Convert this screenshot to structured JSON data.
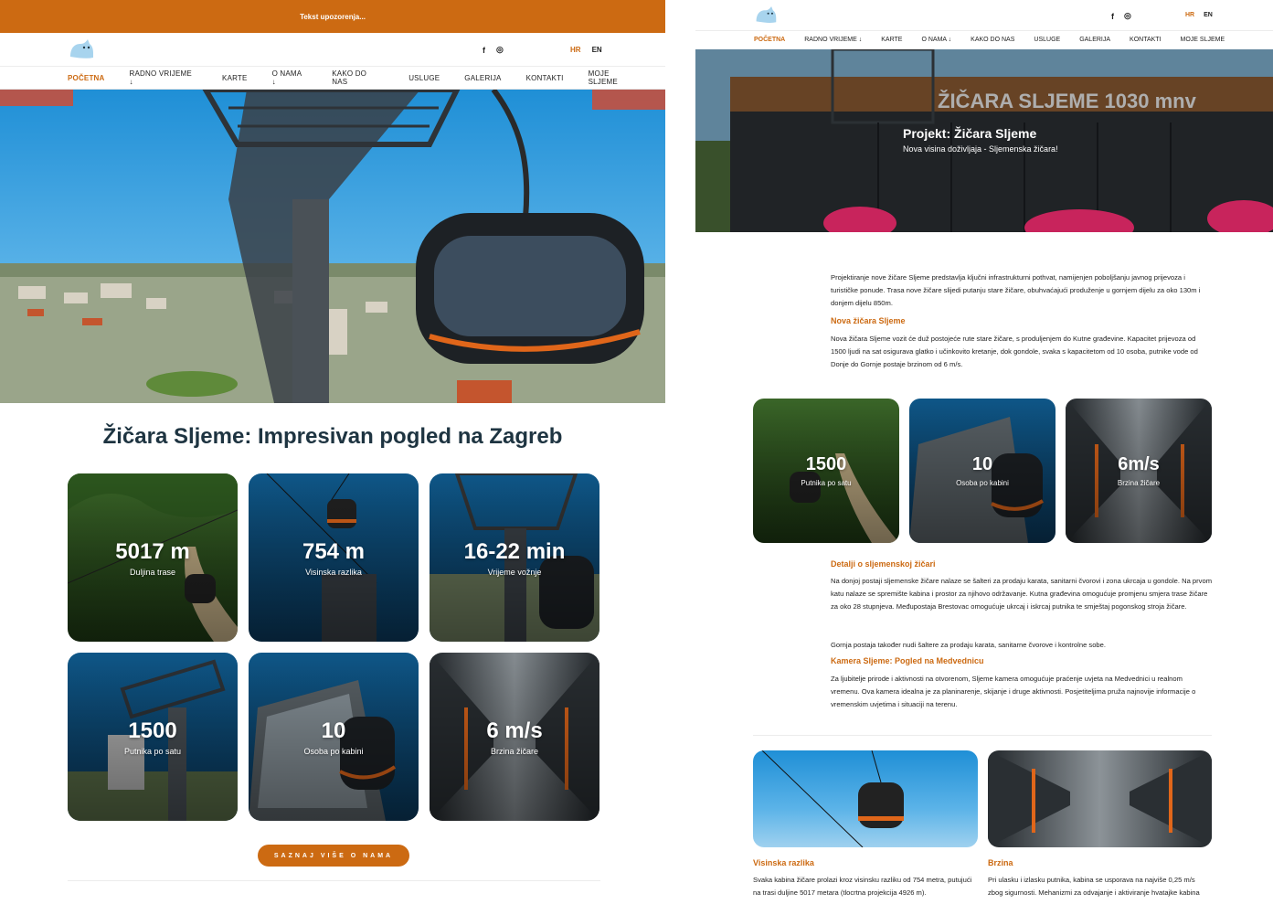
{
  "colors": {
    "accent": "#cc6a12",
    "title": "#1e3441"
  },
  "left": {
    "alert_text": "Tekst upozorenja...",
    "social": {
      "facebook": "f",
      "instagram": "◎"
    },
    "lang": {
      "hr": "HR",
      "en": "EN"
    },
    "nav": [
      {
        "label": "POČETNA",
        "active": true
      },
      {
        "label": "RADNO VRIJEME ↓"
      },
      {
        "label": "KARTE"
      },
      {
        "label": "O NAMA ↓"
      },
      {
        "label": "KAKO DO NAS"
      },
      {
        "label": "USLUGE"
      },
      {
        "label": "GALERIJA"
      },
      {
        "label": "KONTAKTI"
      },
      {
        "label": "MOJE SLJEME"
      }
    ],
    "title": "Žičara Sljeme: Impresivan pogled na Zagreb",
    "stats": [
      {
        "value": "5017 m",
        "label": "Duljina trase"
      },
      {
        "value": "754 m",
        "label": "Visinska razlika"
      },
      {
        "value": "16-22 min",
        "label": "Vrijeme vožnje"
      },
      {
        "value": "1500",
        "label": "Putnika po satu"
      },
      {
        "value": "10",
        "label": "Osoba po kabini"
      },
      {
        "value": "6 m/s",
        "label": "Brzina žičare"
      }
    ],
    "cta_label": "SAZNAJ VIŠE O NAMA"
  },
  "right": {
    "social": {
      "facebook": "f",
      "instagram": "◎"
    },
    "lang": {
      "hr": "HR",
      "en": "EN"
    },
    "nav": [
      {
        "label": "POČETNA",
        "active": true
      },
      {
        "label": "RADNO VRIJEME ↓"
      },
      {
        "label": "KARTE"
      },
      {
        "label": "O NAMA ↓"
      },
      {
        "label": "KAKO DO NAS"
      },
      {
        "label": "USLUGE"
      },
      {
        "label": "GALERIJA"
      },
      {
        "label": "KONTAKTI"
      },
      {
        "label": "MOJE SLJEME"
      }
    ],
    "hero_sign": "ŽIČARA SLJEME 1030 mnv",
    "hero_title": "Projekt: Žičara Sljeme",
    "hero_subtitle": "Nova visina doživljaja - Sljemenska žičara!",
    "intro": "Projektiranje nove žičare Sljeme predstavlja ključni infrastrukturni pothvat, namijenjen poboljšanju javnog prijevoza i turističke ponude. Trasa nove žičare slijedi putanju stare žičare, obuhvaćajući produženje u gornjem dijelu za oko 130m i donjem dijelu 850m.",
    "section1_title": "Nova žičara Sljeme",
    "section1_text": "Nova žičara Sljeme vozit će duž postojeće rute stare žičare, s produljenjem do Kutne građevine. Kapacitet prijevoza od 1500 ljudi na sat osigurava glatko i učinkovito kretanje, dok gondole, svaka s kapacitetom od 10 osoba, putnike vode od Donje do Gornje postaje brzinom od 6 m/s.",
    "stats": [
      {
        "value": "1500",
        "label": "Putnika po satu"
      },
      {
        "value": "10",
        "label": "Osoba po kabini"
      },
      {
        "value": "6m/s",
        "label": "Brzina žičare"
      }
    ],
    "section2_title": "Detalji o sljemenskoj žičari",
    "section2_text": "Na donjoj postaji sljemenske žičare nalaze se šalteri za prodaju karata, sanitarni čvorovi i zona ukrcaja u gondole. Na prvom katu nalaze se spremište kabina i prostor za njihovo održavanje. Kutna građevina omogućuje promjenu smjera trase žičare za oko 28 stupnjeva. Međupostaja Brestovac omogućuje ukrcaj i iskrcaj putnika te smještaj pogonskog stroja žičare.",
    "section2_text_b": "Gornja postaja također nudi šaltere za prodaju karata, sanitarne čvorove i kontrolne sobe.",
    "section3_title": "Kamera Sljeme: Pogled na Medvednicu",
    "section3_text": "Za ljubitelje prirode i aktivnosti na otvorenom, Sljeme kamera omogućuje praćenje uvjeta na Medvednici u realnom vremenu. Ova kamera idealna je za planinarenje, skijanje i druge aktivnosti. Posjetiteljima pruža najnovije informacije o vremenskim uvjetima i situaciji na terenu.",
    "bottom_left_title": "Visinska razlika",
    "bottom_left_text": "Svaka kabina žičare prolazi kroz visinsku razliku od 754 metra, putujući na trasi duljine 5017 metara (tlocrtna projekcija 4926 m).",
    "bottom_right_title": "Brzina",
    "bottom_right_text": "Pri ulasku i izlasku putnika, kabina se usporava na najviše 0,25 m/s zbog sigurnosti. Mehanizmi za odvajanje i aktiviranje hvatajke kabina"
  }
}
